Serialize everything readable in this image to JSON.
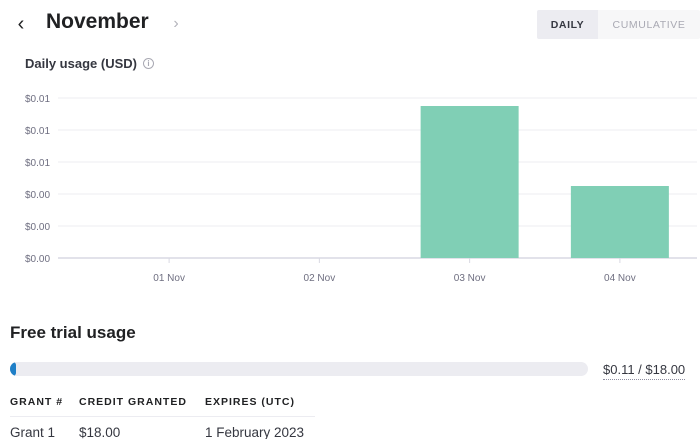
{
  "header": {
    "prev_icon": "chevron-left-icon",
    "prev_glyph": "‹",
    "title": "November",
    "next_icon": "chevron-right-icon",
    "next_glyph": "›",
    "view_toggle": {
      "daily_label": "DAILY",
      "cumulative_label": "CUMULATIVE",
      "selected": "DAILY"
    }
  },
  "chart_section": {
    "heading": "Daily usage (USD)",
    "info_icon": "info-icon",
    "info_glyph": "i"
  },
  "chart_data": {
    "type": "bar",
    "title": "Daily usage (USD)",
    "categories": [
      "01 Nov",
      "02 Nov",
      "03 Nov",
      "04 Nov"
    ],
    "values": [
      0,
      0,
      0.0095,
      0.0045
    ],
    "ylim": [
      0,
      0.01
    ],
    "y_ticks": [
      0,
      0.002,
      0.004,
      0.006,
      0.008,
      0.01
    ],
    "y_tick_labels": [
      "$0.00",
      "$0.00",
      "$0.00",
      "$0.01",
      "$0.01",
      "$0.01"
    ],
    "grid": true,
    "bar_color": "#80cfb5"
  },
  "free_trial": {
    "title": "Free trial usage",
    "progress_fraction": 0.0061,
    "progress_label": "$0.11 / $18.00",
    "progress_color": "#1f7fc7"
  },
  "grants": {
    "columns": [
      "GRANT #",
      "CREDIT GRANTED",
      "EXPIRES (UTC)"
    ],
    "rows": [
      [
        "Grant 1",
        "$18.00",
        "1 February 2023"
      ]
    ]
  }
}
